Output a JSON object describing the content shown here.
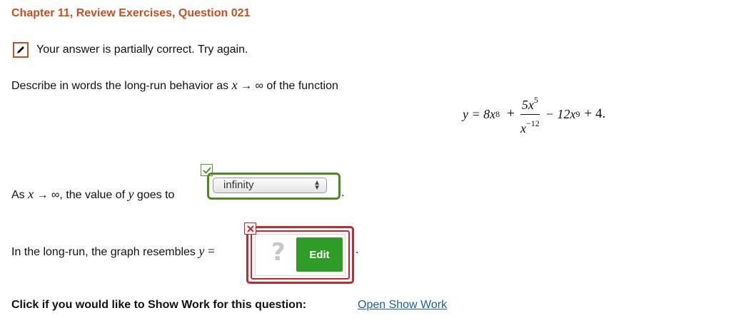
{
  "header": {
    "title": "Chapter 11, Review Exercises, Question 021"
  },
  "feedback": {
    "icon": "pencil-icon",
    "message": "Your answer is partially correct.  Try again.",
    "color": "#c8501e"
  },
  "prompt": {
    "text_before": "Describe in words the long-run behavior as ",
    "var_x": "x",
    "arrow": " → ",
    "infinity": "∞",
    "text_after": " of the function"
  },
  "formula": {
    "lhs": "y = 8x",
    "exp1": "8",
    "plus": "+",
    "num_base": "5x",
    "num_exp": "5",
    "den_base": "x",
    "den_exp": "−12",
    "minus_term": "− 12x",
    "exp3": "9",
    "tail": "+ 4."
  },
  "question1": {
    "as": "As ",
    "x": "x",
    "arrow": " → ",
    "inf": "∞",
    "text": ", the value of ",
    "y": "y",
    "goes_to": " goes to ",
    "selected": "infinity",
    "status": "correct",
    "status_icon": "check-icon",
    "period": "."
  },
  "question2": {
    "text": "In the long-run, the graph resembles ",
    "y": "y",
    "eq": " =",
    "placeholder_icon": "question-mark-icon",
    "placeholder": "?",
    "edit_label": "Edit",
    "status": "incorrect",
    "status_icon": "x-icon",
    "period": "."
  },
  "footer": {
    "show_work_label": "Click if you would like to Show Work for this question:",
    "link": "Open Show Work"
  },
  "colors": {
    "accent": "#c8501e",
    "correct": "#4d8a25",
    "incorrect": "#d2232a",
    "link": "#1a5faa",
    "edit_button": "#2e9c26"
  }
}
